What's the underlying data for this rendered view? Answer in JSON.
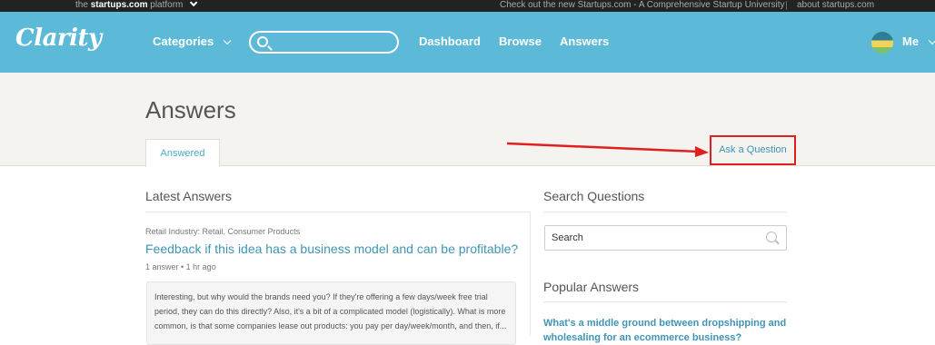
{
  "topbar": {
    "the": "the",
    "brand": "startups.com",
    "platform": "platform",
    "promo": "Check out the new Startups.com - A Comprehensive Startup University",
    "about": "about startups.com"
  },
  "header": {
    "logo": "Clarity",
    "categories": "Categories",
    "search_placeholder": "",
    "nav": [
      "Dashboard",
      "Browse",
      "Answers"
    ],
    "me": "Me"
  },
  "page": {
    "title": "Answers",
    "tab": "Answered",
    "ask_button": "Ask a Question"
  },
  "latest": {
    "heading": "Latest Answers",
    "item": {
      "category": "Retail Industry: Retail, Consumer Products",
      "title": "Feedback if this idea has a business model and can be profitable?",
      "meta": "1 answer • 1 hr ago",
      "snippet": "Interesting, but why would the brands need you? If they're offering a few days/week free trial period, they can do this directly? Also, it's a bit of a complicated model (logistically). What is more common, is that some companies lease out products: you pay per day/week/month, and then, if..."
    }
  },
  "sidebar": {
    "search_heading": "Search Questions",
    "search_placeholder": "Search",
    "popular_heading": "Popular Answers",
    "popular_item": "What's a middle ground between dropshipping and wholesaling for an ecommerce business?"
  },
  "colors": {
    "header_bg": "#5cb9d8",
    "link": "#3e95b5",
    "annotation": "#e02020"
  }
}
